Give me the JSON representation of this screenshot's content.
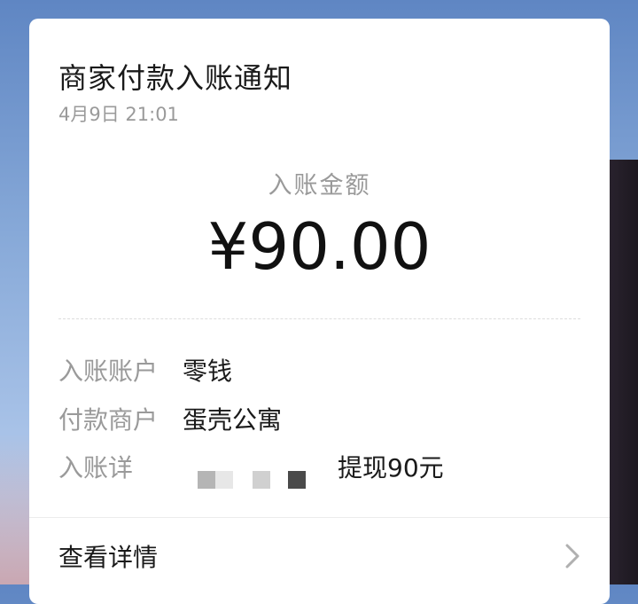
{
  "notification": {
    "title": "商家付款入账通知",
    "datetime": "4月9日  21:01",
    "amount_label": "入账金额",
    "amount": "¥90.00",
    "rows": [
      {
        "label": "入账账户",
        "value": "零钱"
      },
      {
        "label": "付款商户",
        "value": "蛋壳公寓"
      },
      {
        "label": "入账详",
        "value": "提现90元"
      }
    ],
    "footer_label": "查看详情",
    "chevron_icon": "chevron-right-icon"
  }
}
